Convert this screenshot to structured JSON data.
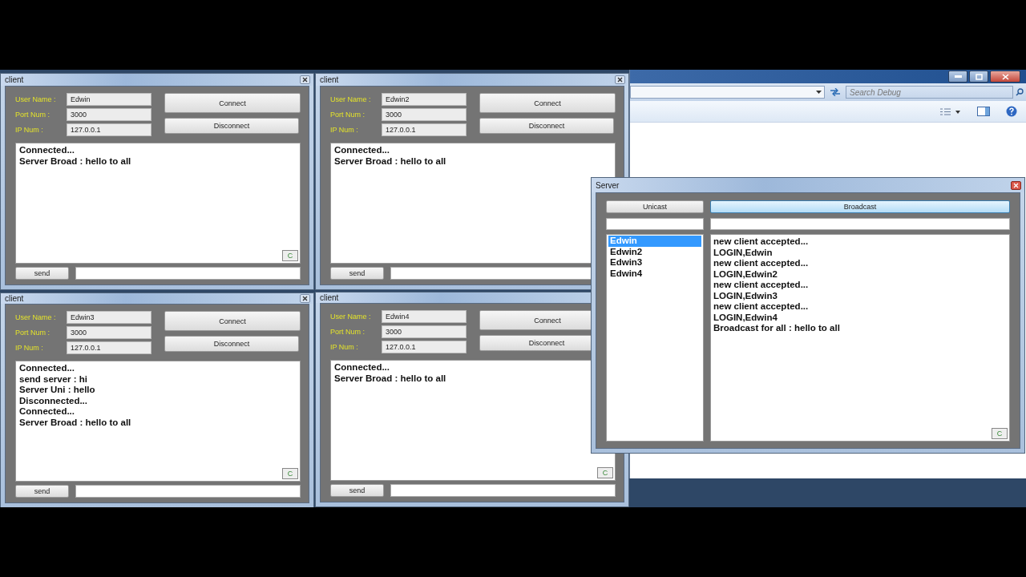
{
  "background_window": {
    "search": {
      "placeholder": "Search Debug"
    }
  },
  "clients": [
    {
      "title": "client",
      "user_name_label": "User Name :",
      "user_name": "Edwin",
      "port_label": "Port Num :",
      "port": "3000",
      "ip_label": "IP Num :",
      "ip": "127.0.0.1",
      "connect": "Connect",
      "disconnect": "Disconnect",
      "log": [
        "Connected...",
        "Server Broad : hello to all"
      ],
      "clear_button": "C",
      "send": "send"
    },
    {
      "title": "client",
      "user_name_label": "User Name :",
      "user_name": "Edwin2",
      "port_label": "Port Num :",
      "port": "3000",
      "ip_label": "IP Num :",
      "ip": "127.0.0.1",
      "connect": "Connect",
      "disconnect": "Disconnect",
      "log": [
        "Connected...",
        "Server Broad : hello to all"
      ],
      "send": "send"
    },
    {
      "title": "client",
      "user_name_label": "User Name :",
      "user_name": "Edwin3",
      "port_label": "Port Num :",
      "port": "3000",
      "ip_label": "IP Num :",
      "ip": "127.0.0.1",
      "connect": "Connect",
      "disconnect": "Disconnect",
      "log": [
        "Connected...",
        "send server : hi",
        "Server Uni : hello",
        "Disconnected...",
        "Connected...",
        "Server Broad : hello to all"
      ],
      "clear_button": "C",
      "send": "send"
    },
    {
      "title": "client",
      "user_name_label": "User Name :",
      "user_name": "Edwin4",
      "port_label": "Port Num :",
      "port": "3000",
      "ip_label": "IP Num :",
      "ip": "127.0.0.1",
      "connect": "Connect",
      "disconnect": "Disconnect",
      "log": [
        "Connected...",
        "Server Broad : hello to all"
      ],
      "clear_button": "C",
      "send": "send"
    }
  ],
  "server": {
    "title": "Server",
    "unicast": "Unicast",
    "broadcast": {
      "label": "Broadcast",
      "hovered": true
    },
    "clients": [
      {
        "name": "Edwin",
        "selected": true
      },
      {
        "name": "Edwin2",
        "selected": false
      },
      {
        "name": "Edwin3",
        "selected": false
      },
      {
        "name": "Edwin4",
        "selected": false
      }
    ],
    "log": [
      "new client accepted...",
      "LOGIN,Edwin",
      "new client accepted...",
      "LOGIN,Edwin2",
      "new client accepted...",
      "LOGIN,Edwin3",
      "new client accepted...",
      "LOGIN,Edwin4",
      "Broadcast for all : hello to all"
    ],
    "clear_button": "C"
  }
}
